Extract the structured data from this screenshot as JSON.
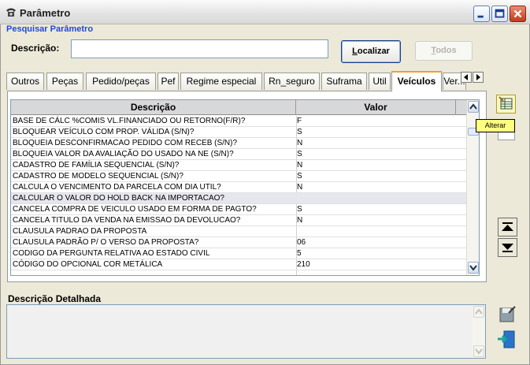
{
  "window": {
    "title": "Parâmetro",
    "buttons": {
      "minimize": "minimize-icon",
      "maximize": "maximize-icon",
      "close": "close-icon"
    }
  },
  "search": {
    "caption": "Pesquisar Parâmetro",
    "label": "Descrição:",
    "value": "",
    "buttons": {
      "find_prefix": "L",
      "find_rest": "ocalizar",
      "all_prefix": "T",
      "all_rest": "odos"
    }
  },
  "tabs": [
    "Outros",
    "Peças",
    "Pedido/peças",
    "Pef",
    "Regime especial",
    "Rn_seguro",
    "Suframa",
    "Util",
    "Veículos",
    "Ver..."
  ],
  "active_tab": "Veículos",
  "grid": {
    "columns": [
      "Descrição",
      "Valor"
    ],
    "rows": [
      {
        "descricao": "BASE DE CÁLC %COMIS VL.FINANCIADO OU RETORNO(F/R)?",
        "valor": "F"
      },
      {
        "descricao": "BLOQUEAR VEÍCULO COM PROP. VÁLIDA (S/N)?",
        "valor": "S"
      },
      {
        "descricao": "BLOQUEIA DESCONFIRMACAO PEDIDO COM RECEB (S/N)?",
        "valor": "N"
      },
      {
        "descricao": "BLOQUEIA VALOR DA AVALIAÇÃO DO USADO NA NE (S/N)?",
        "valor": "S"
      },
      {
        "descricao": "CADASTRO DE FAMÍLIA SEQUENCIAL (S/N)?",
        "valor": "N"
      },
      {
        "descricao": "CADASTRO DE MODELO SEQUENCIAL (S/N)?",
        "valor": "S"
      },
      {
        "descricao": "CALCULA O VENCIMENTO DA PARCELA COM DIA UTIL?",
        "valor": "N"
      },
      {
        "descricao": "CALCULAR O VALOR DO HOLD BACK NA IMPORTACAO?",
        "valor": ""
      },
      {
        "descricao": "CANCELA COMPRA DE VEICULO USADO EM FORMA DE PAGTO?",
        "valor": "S"
      },
      {
        "descricao": "CANCELA TITULO DA VENDA NA EMISSAO DA DEVOLUCAO?",
        "valor": "N"
      },
      {
        "descricao": "CLAUSULA PADRAO DA PROPOSTA",
        "valor": ""
      },
      {
        "descricao": "CLAUSULA PADRÃO P/ O VERSO DA PROPOSTA?",
        "valor": "06"
      },
      {
        "descricao": "CODIGO DA PERGUNTA RELATIVA AO ESTADO CIVIL",
        "valor": "5"
      },
      {
        "descricao": "CÓDIGO DO OPCIONAL COR METÁLICA",
        "valor": "210"
      }
    ],
    "selected_row": 7
  },
  "toolbar": {
    "tooltip": "Alterar"
  },
  "detail": {
    "label": "Descrição Detalhada",
    "value": ""
  },
  "colors": {
    "caption_blue": "#1f49d6",
    "tab_active_accent": "#f0a030",
    "tooltip_bg": "#ffff80"
  }
}
